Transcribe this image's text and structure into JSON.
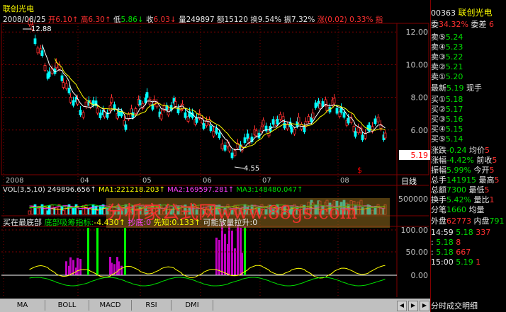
{
  "header": {
    "title": "联创光电",
    "date": "2008/08/25",
    "open_label": "开",
    "open": "6.10",
    "high_label": "高",
    "high": "6.30",
    "low_label": "低",
    "low": "5.86",
    "close_label": "收",
    "close": "6.03",
    "volume_label": "量",
    "volume": "249897",
    "amount_label": "额",
    "amount": "15120",
    "turnover_label": "换",
    "turnover": "9.54%",
    "amplitude_label": "振",
    "amplitude": "7.32%",
    "change_label": "涨",
    "change": "(0.02)",
    "change_pct": "0.33%",
    "right_edge": "指"
  },
  "price_axis": [
    "12.00",
    "10.00",
    "8.00",
    "6.00"
  ],
  "price_highlight": "5.19",
  "annotations": {
    "high": "12.88",
    "low": "4.55"
  },
  "month_labels": [
    "2008",
    "04",
    "05",
    "06",
    "07",
    "08"
  ],
  "day_tab": "日线",
  "volume_panel": {
    "title": "VOL(3,5,10)",
    "vol": "249896.656",
    "ma1_label": "MA1:",
    "ma1": "221218.203",
    "ma2_label": "MA2:",
    "ma2": "169597.281",
    "ma3_label": "MA3:",
    "ma3": "148480.047",
    "axis": [
      "500000"
    ]
  },
  "indicator_panel": {
    "title": "买在最底部",
    "item1": "底部吸筹指标:",
    "item1_val": "-4.430",
    "item2": "抄底:0",
    "item3": "先知:0.133",
    "item4": "可能放量拉升:0",
    "axis": [
      "100.00",
      "50.00",
      "0.00"
    ]
  },
  "watermark": "分析家公式网www.88gs.com",
  "tabs": [
    "MA",
    "BOLL",
    "MACD",
    "RSI",
    "DMI"
  ],
  "right_panel": {
    "code": "00363",
    "name": "联创光电",
    "row_ratio": {
      "l": "委",
      "v": "34.32%",
      "l2": "委差",
      "v2": "6"
    },
    "sells": [
      {
        "label": "卖⑤",
        "price": "5.24"
      },
      {
        "label": "卖④",
        "price": "5.23"
      },
      {
        "label": "卖③",
        "price": "5.22"
      },
      {
        "label": "卖②",
        "price": "5.21"
      },
      {
        "label": "卖①",
        "price": "5.20"
      }
    ],
    "last": {
      "label": "最新",
      "price": "5.19",
      "label2": "现手"
    },
    "buys": [
      {
        "label": "买①",
        "price": "5.18"
      },
      {
        "label": "买②",
        "price": "5.17"
      },
      {
        "label": "买③",
        "price": "5.16"
      },
      {
        "label": "买④",
        "price": "5.15"
      },
      {
        "label": "买⑤",
        "price": "5.14"
      }
    ],
    "stats": [
      {
        "t": "涨跌",
        "v": "-0.24",
        "t2": "均价",
        "v2": "5"
      },
      {
        "t": "涨幅",
        "v": "-4.42%",
        "t2": "前收",
        "v2": "5"
      },
      {
        "t": "振幅",
        "v": "5.99%",
        "t2": "今开",
        "v2": "5"
      },
      {
        "t": "总手",
        "v": "141915",
        "t2": "最高",
        "v2": "5"
      },
      {
        "t": "总额",
        "v": "7300",
        "t2": "最低",
        "v2": "5"
      },
      {
        "t": "换手",
        "v": "5.42%",
        "t2": "量比",
        "v2": "1"
      },
      {
        "t": "分笔",
        "v": "1660",
        "t2": "均量",
        "v2": ""
      }
    ],
    "outer": {
      "l": "外盘",
      "v": "62773",
      "l2": "内盘",
      "v2": "791"
    },
    "ticks": [
      {
        "time": "14:59",
        "price": "5.18",
        "vol": "337"
      },
      {
        "time": ":",
        "price": "5.18",
        "vol": "8"
      },
      {
        "time": ":",
        "price": "5.18",
        "vol": "667"
      },
      {
        "time": "15:00",
        "price": "5.19",
        "vol": "1"
      }
    ],
    "bottom": "分时成交明细"
  },
  "colors": {
    "up": "#ff3030",
    "down": "#00ffff",
    "grid": "#800000",
    "yellow": "#ffff00",
    "ma2": "#ff40ff",
    "ma3": "#00e000",
    "ind_bar": "#c000c0",
    "signal": "#00ff00"
  }
}
